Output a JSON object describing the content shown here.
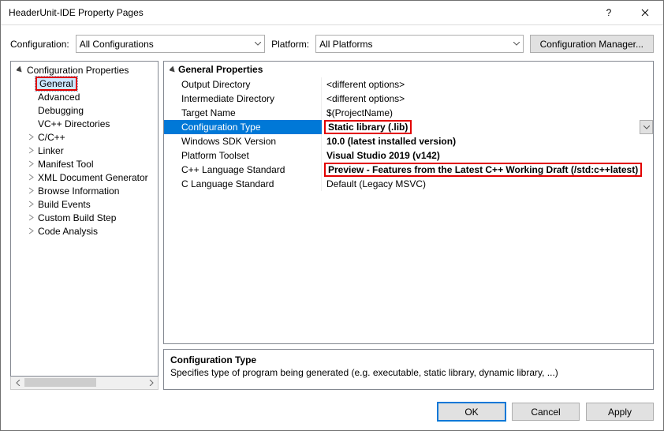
{
  "window": {
    "title": "HeaderUnit-IDE Property Pages"
  },
  "toolbar": {
    "config_label": "Configuration:",
    "config_value": "All Configurations",
    "platform_label": "Platform:",
    "platform_value": "All Platforms",
    "manager_label": "Configuration Manager..."
  },
  "tree": {
    "root": "Configuration Properties",
    "items": [
      {
        "label": "General",
        "expandable": false,
        "highlight": true,
        "selected": true
      },
      {
        "label": "Advanced",
        "expandable": false
      },
      {
        "label": "Debugging",
        "expandable": false
      },
      {
        "label": "VC++ Directories",
        "expandable": false
      },
      {
        "label": "C/C++",
        "expandable": true
      },
      {
        "label": "Linker",
        "expandable": true
      },
      {
        "label": "Manifest Tool",
        "expandable": true
      },
      {
        "label": "XML Document Generator",
        "expandable": true
      },
      {
        "label": "Browse Information",
        "expandable": true
      },
      {
        "label": "Build Events",
        "expandable": true
      },
      {
        "label": "Custom Build Step",
        "expandable": true
      },
      {
        "label": "Code Analysis",
        "expandable": true
      }
    ]
  },
  "grid": {
    "category": "General Properties",
    "rows": [
      {
        "name": "Output Directory",
        "value": "<different options>"
      },
      {
        "name": "Intermediate Directory",
        "value": "<different options>"
      },
      {
        "name": "Target Name",
        "value": "$(ProjectName)"
      },
      {
        "name": "Configuration Type",
        "value": "Static library (.lib)",
        "selected": true,
        "bold": true,
        "highlight": true,
        "dropdown": true
      },
      {
        "name": "Windows SDK Version",
        "value": "10.0 (latest installed version)",
        "bold": true
      },
      {
        "name": "Platform Toolset",
        "value": "Visual Studio 2019 (v142)",
        "bold": true
      },
      {
        "name": "C++ Language Standard",
        "value": "Preview - Features from the Latest C++ Working Draft (/std:c++latest)",
        "bold": true,
        "highlight": true
      },
      {
        "name": "C Language Standard",
        "value": "Default (Legacy MSVC)"
      }
    ]
  },
  "desc": {
    "title": "Configuration Type",
    "text": "Specifies type of program being generated (e.g. executable, static library, dynamic library, ...)"
  },
  "footer": {
    "ok": "OK",
    "cancel": "Cancel",
    "apply": "Apply"
  }
}
